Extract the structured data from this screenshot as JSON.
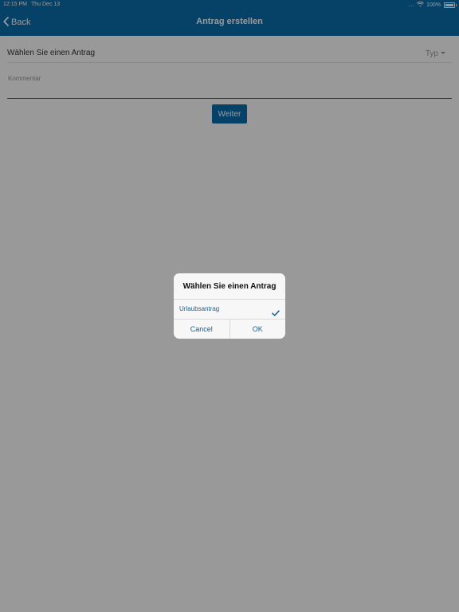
{
  "status_bar": {
    "time": "12:15 PM",
    "date": "Thu Dec 13",
    "signal": "...",
    "battery_percent_label": "100%",
    "battery_level": 1.0
  },
  "navbar": {
    "back_label": "Back",
    "title": "Antrag erstellen"
  },
  "form": {
    "type_label": "Wählen Sie einen Antrag",
    "type_select_value": "Typ",
    "comment_placeholder": "Kommentar",
    "next_button": "Weiter"
  },
  "dialog": {
    "title": "Wählen Sie einen Antrag",
    "options": [
      {
        "label": "Urlaubsantrag",
        "selected": true
      }
    ],
    "cancel": "Cancel",
    "ok": "OK"
  },
  "colors": {
    "accent": "#0b6fad",
    "dialog_text": "#1a5f8f",
    "overlay": "rgba(0,0,0,0.4)"
  },
  "icons": {
    "back": "chevron-left-icon",
    "wifi": "wifi-icon",
    "battery": "battery-icon",
    "caret": "caret-down-icon",
    "check": "checkmark-icon"
  }
}
